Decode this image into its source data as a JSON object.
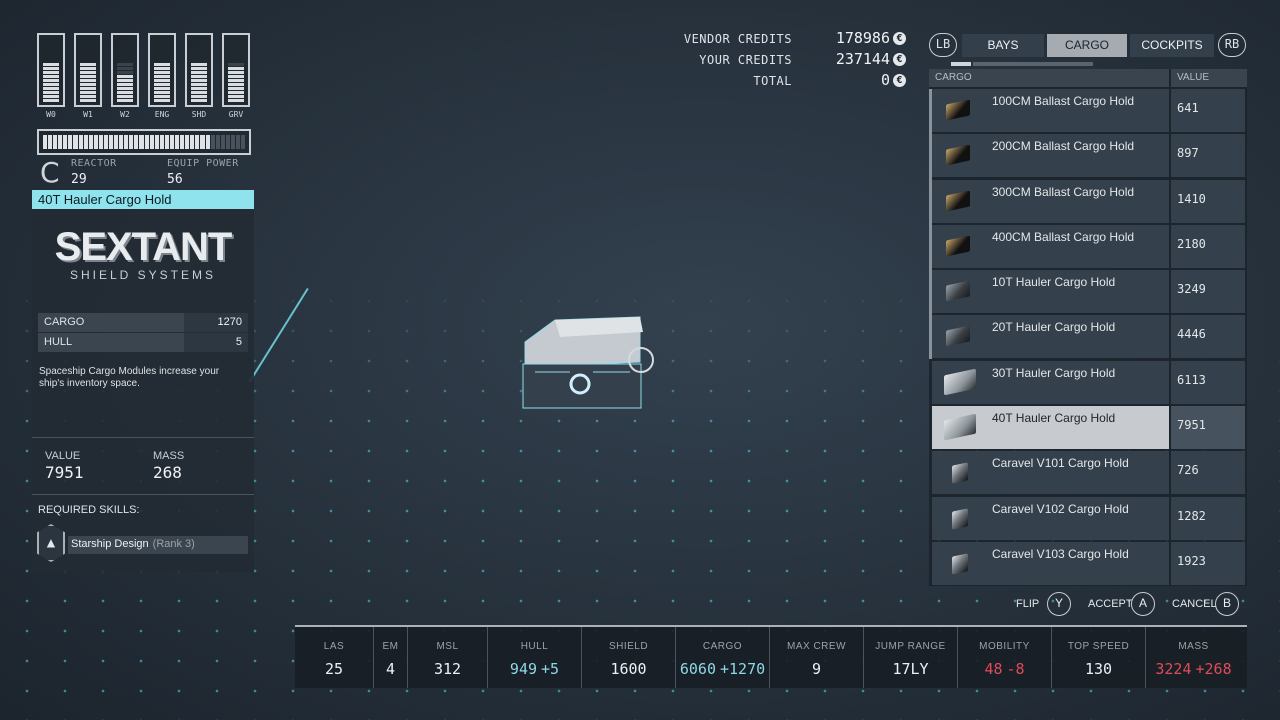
{
  "colors": {
    "accent": "#8ee3ec",
    "increase": "#8ed8e6",
    "decrease": "#e04b5a",
    "panel": "#34404b",
    "selected_row": "#c7cbcf"
  },
  "power": {
    "bars": [
      {
        "label": "W0",
        "level": 10,
        "max": 10
      },
      {
        "label": "W1",
        "level": 10,
        "max": 10
      },
      {
        "label": "W2",
        "level": 7,
        "max": 10
      },
      {
        "label": "ENG",
        "level": 10,
        "max": 10
      },
      {
        "label": "SHD",
        "level": 10,
        "max": 10
      },
      {
        "label": "GRV",
        "level": 9,
        "max": 10
      }
    ],
    "reactor_fill_fraction": 0.82
  },
  "reactor": {
    "class": "C",
    "reactor_label": "REACTOR",
    "reactor_value": "29",
    "equip_label": "EQUIP POWER",
    "equip_value": "56"
  },
  "item": {
    "title": "40T Hauler Cargo Hold",
    "brand": "SEXTANT",
    "brand_sub": "SHIELD SYSTEMS",
    "stats": [
      {
        "label": "CARGO",
        "value": "1270"
      },
      {
        "label": "HULL",
        "value": "5"
      }
    ],
    "description": "Spaceship Cargo Modules increase your ship's inventory space.",
    "value_label": "VALUE",
    "value": "7951",
    "mass_label": "MASS",
    "mass": "268",
    "required_skills_label": "REQUIRED SKILLS:",
    "skill_name": "Starship Design",
    "skill_rank": "(Rank 3)",
    "skill_icon": "rocket-icon"
  },
  "credits": {
    "vendor_label": "VENDOR CREDITS",
    "vendor_value": "178986",
    "your_label": "YOUR CREDITS",
    "your_value": "237144",
    "total_label": "TOTAL",
    "total_value": "0",
    "icon": "credits-icon"
  },
  "tabs": {
    "lb": "LB",
    "rb": "RB",
    "items": [
      {
        "label": "BAYS",
        "active": false
      },
      {
        "label": "CARGO",
        "active": true
      },
      {
        "label": "COCKPITS",
        "active": false
      }
    ]
  },
  "list": {
    "col_name": "CARGO",
    "col_value": "VALUE",
    "rows": [
      {
        "name": "100CM Ballast Cargo Hold",
        "value": "641",
        "thumb": "ballast"
      },
      {
        "name": "200CM Ballast Cargo Hold",
        "value": "897",
        "thumb": "ballast"
      },
      {
        "name": "300CM Ballast Cargo Hold",
        "value": "1410",
        "thumb": "ballast"
      },
      {
        "name": "400CM Ballast Cargo Hold",
        "value": "2180",
        "thumb": "ballast"
      },
      {
        "name": "10T Hauler Cargo Hold",
        "value": "3249",
        "thumb": "hauler"
      },
      {
        "name": "20T Hauler Cargo Hold",
        "value": "4446",
        "thumb": "hauler"
      },
      {
        "name": "30T Hauler Cargo Hold",
        "value": "6113",
        "thumb": "large"
      },
      {
        "name": "40T Hauler Cargo Hold",
        "value": "7951",
        "thumb": "large",
        "selected": true
      },
      {
        "name": "Caravel V101 Cargo Hold",
        "value": "726",
        "thumb": "caravel"
      },
      {
        "name": "Caravel V102 Cargo Hold",
        "value": "1282",
        "thumb": "caravel"
      },
      {
        "name": "Caravel V103 Cargo Hold",
        "value": "1923",
        "thumb": "caravel"
      }
    ]
  },
  "actions": {
    "flip_label": "FLIP",
    "flip_key": "Y",
    "accept_label": "ACCEPT",
    "accept_key": "A",
    "cancel_label": "CANCEL",
    "cancel_key": "B"
  },
  "ship_stats": [
    {
      "label": "LAS",
      "value": "25"
    },
    {
      "label": "EM",
      "value": "4"
    },
    {
      "label": "MSL",
      "value": "312"
    },
    {
      "label": "HULL",
      "value": "949",
      "delta": "+5",
      "tone": "pos"
    },
    {
      "label": "SHIELD",
      "value": "1600"
    },
    {
      "label": "CARGO",
      "value": "6060",
      "delta": "+1270",
      "tone": "pos"
    },
    {
      "label": "MAX CREW",
      "value": "9"
    },
    {
      "label": "JUMP RANGE",
      "value": "17LY"
    },
    {
      "label": "MOBILITY",
      "value": "48",
      "delta": "-8",
      "tone": "neg"
    },
    {
      "label": "TOP SPEED",
      "value": "130"
    },
    {
      "label": "MASS",
      "value": "3224",
      "delta": "+268",
      "tone": "neg"
    }
  ]
}
